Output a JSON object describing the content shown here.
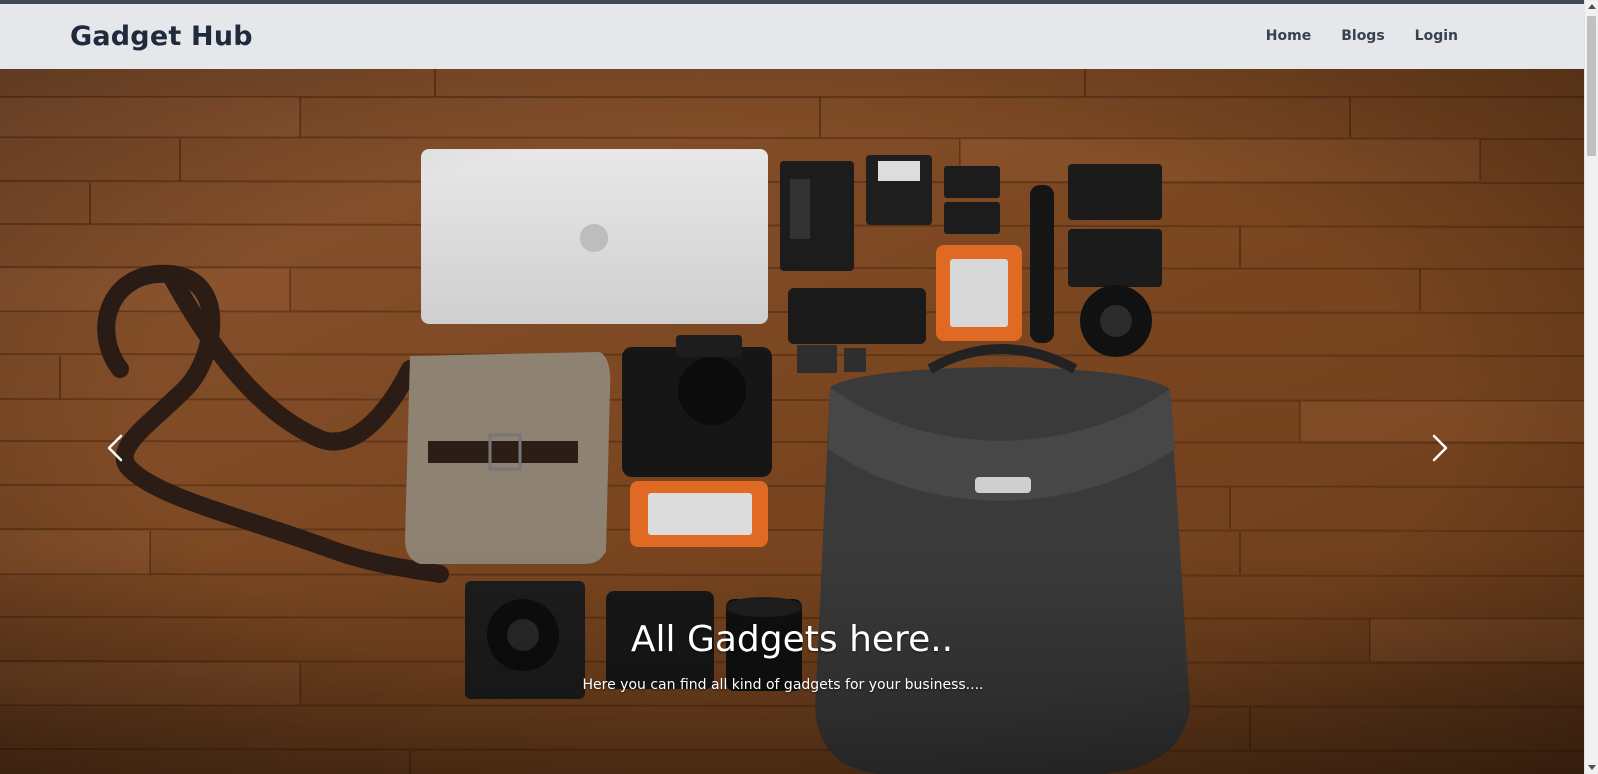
{
  "navbar": {
    "brand": "Gadget Hub",
    "links": [
      "Home",
      "Blogs",
      "Login"
    ]
  },
  "hero": {
    "title": "All Gadgets here..",
    "subtitle": "Here you can find all kind of gadgets for your business....",
    "image_description": "flat lay of gadgets on wooden floor",
    "prev_icon": "chevron-left-icon",
    "next_icon": "chevron-right-icon"
  },
  "colors": {
    "navbar_bg": "#e5e7eb",
    "brand_text": "#1f2a3c",
    "nav_text": "#374151",
    "wood": "#8b5128"
  }
}
